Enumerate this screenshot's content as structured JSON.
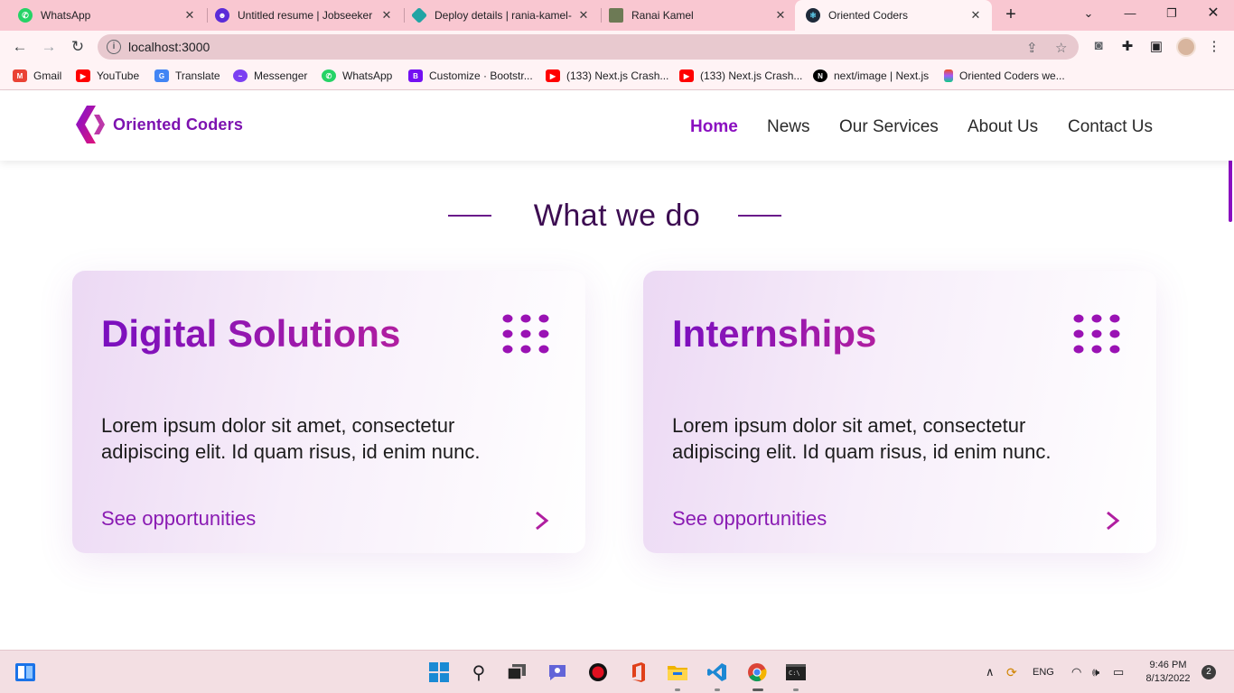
{
  "browser": {
    "tabs": [
      {
        "title": "WhatsApp",
        "icon": "whatsapp-icon",
        "color": "#25d366"
      },
      {
        "title": "Untitled resume | Jobseeker",
        "icon": "jobseeker-icon",
        "color": "#5b2bd8"
      },
      {
        "title": "Deploy details | rania-kamel-",
        "icon": "netlify-icon",
        "color": "#20a4a4"
      },
      {
        "title": "Ranai Kamel",
        "icon": "portfolio-icon",
        "color": "#6d7a55"
      },
      {
        "title": "Oriented Coders",
        "icon": "react-icon",
        "color": "#1e2a3a"
      }
    ],
    "url": "localhost:3000",
    "bookmarks": [
      {
        "label": "Gmail",
        "icon": "gmail-icon",
        "color": "#ea4335"
      },
      {
        "label": "YouTube",
        "icon": "youtube-icon",
        "color": "#ff0000"
      },
      {
        "label": "Translate",
        "icon": "translate-icon",
        "color": "#4285f4"
      },
      {
        "label": "Messenger",
        "icon": "messenger-icon",
        "color": "#7b3ff2"
      },
      {
        "label": "WhatsApp",
        "icon": "whatsapp-icon",
        "color": "#25d366"
      },
      {
        "label": "Customize · Bootstr...",
        "icon": "bootstrap-icon",
        "color": "#7410f2"
      },
      {
        "label": "(133) Next.js Crash...",
        "icon": "youtube-icon",
        "color": "#ff0000"
      },
      {
        "label": "(133) Next.js Crash...",
        "icon": "youtube-icon",
        "color": "#ff0000"
      },
      {
        "label": "next/image | Next.js",
        "icon": "nextjs-icon",
        "color": "#000000"
      },
      {
        "label": "Oriented Coders we...",
        "icon": "figma-icon",
        "color": "#f24e1e"
      }
    ]
  },
  "site": {
    "brand": "Oriented Coders",
    "nav": [
      "Home",
      "News",
      "Our Services",
      "About Us",
      "Contact Us"
    ],
    "active_nav": "Home",
    "accent": "#8a0fc0",
    "section_title": "What we do",
    "cards": [
      {
        "title": "Digital Solutions",
        "body": "Lorem ipsum dolor sit amet, consectetur adipiscing elit. Id quam risus, id enim nunc.",
        "link": "See opportunities"
      },
      {
        "title": "Internships",
        "body": "Lorem ipsum dolor sit amet, consectetur adipiscing elit. Id quam risus, id enim nunc.",
        "link": "See opportunities"
      }
    ]
  },
  "taskbar": {
    "language": "ENG",
    "time": "9:46 PM",
    "date": "8/13/2022",
    "notifications": "2"
  }
}
